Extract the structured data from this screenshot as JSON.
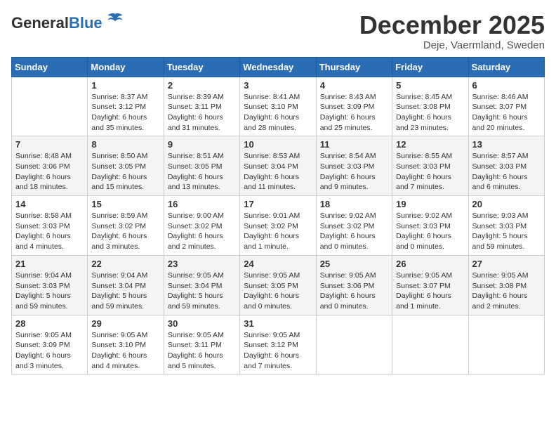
{
  "header": {
    "logo_general": "General",
    "logo_blue": "Blue",
    "month_title": "December 2025",
    "subtitle": "Deje, Vaermland, Sweden"
  },
  "days_of_week": [
    "Sunday",
    "Monday",
    "Tuesday",
    "Wednesday",
    "Thursday",
    "Friday",
    "Saturday"
  ],
  "weeks": [
    [
      {
        "day": "",
        "info": ""
      },
      {
        "day": "1",
        "info": "Sunrise: 8:37 AM\nSunset: 3:12 PM\nDaylight: 6 hours\nand 35 minutes."
      },
      {
        "day": "2",
        "info": "Sunrise: 8:39 AM\nSunset: 3:11 PM\nDaylight: 6 hours\nand 31 minutes."
      },
      {
        "day": "3",
        "info": "Sunrise: 8:41 AM\nSunset: 3:10 PM\nDaylight: 6 hours\nand 28 minutes."
      },
      {
        "day": "4",
        "info": "Sunrise: 8:43 AM\nSunset: 3:09 PM\nDaylight: 6 hours\nand 25 minutes."
      },
      {
        "day": "5",
        "info": "Sunrise: 8:45 AM\nSunset: 3:08 PM\nDaylight: 6 hours\nand 23 minutes."
      },
      {
        "day": "6",
        "info": "Sunrise: 8:46 AM\nSunset: 3:07 PM\nDaylight: 6 hours\nand 20 minutes."
      }
    ],
    [
      {
        "day": "7",
        "info": "Sunrise: 8:48 AM\nSunset: 3:06 PM\nDaylight: 6 hours\nand 18 minutes."
      },
      {
        "day": "8",
        "info": "Sunrise: 8:50 AM\nSunset: 3:05 PM\nDaylight: 6 hours\nand 15 minutes."
      },
      {
        "day": "9",
        "info": "Sunrise: 8:51 AM\nSunset: 3:05 PM\nDaylight: 6 hours\nand 13 minutes."
      },
      {
        "day": "10",
        "info": "Sunrise: 8:53 AM\nSunset: 3:04 PM\nDaylight: 6 hours\nand 11 minutes."
      },
      {
        "day": "11",
        "info": "Sunrise: 8:54 AM\nSunset: 3:03 PM\nDaylight: 6 hours\nand 9 minutes."
      },
      {
        "day": "12",
        "info": "Sunrise: 8:55 AM\nSunset: 3:03 PM\nDaylight: 6 hours\nand 7 minutes."
      },
      {
        "day": "13",
        "info": "Sunrise: 8:57 AM\nSunset: 3:03 PM\nDaylight: 6 hours\nand 6 minutes."
      }
    ],
    [
      {
        "day": "14",
        "info": "Sunrise: 8:58 AM\nSunset: 3:03 PM\nDaylight: 6 hours\nand 4 minutes."
      },
      {
        "day": "15",
        "info": "Sunrise: 8:59 AM\nSunset: 3:02 PM\nDaylight: 6 hours\nand 3 minutes."
      },
      {
        "day": "16",
        "info": "Sunrise: 9:00 AM\nSunset: 3:02 PM\nDaylight: 6 hours\nand 2 minutes."
      },
      {
        "day": "17",
        "info": "Sunrise: 9:01 AM\nSunset: 3:02 PM\nDaylight: 6 hours\nand 1 minute."
      },
      {
        "day": "18",
        "info": "Sunrise: 9:02 AM\nSunset: 3:02 PM\nDaylight: 6 hours\nand 0 minutes."
      },
      {
        "day": "19",
        "info": "Sunrise: 9:02 AM\nSunset: 3:03 PM\nDaylight: 6 hours\nand 0 minutes."
      },
      {
        "day": "20",
        "info": "Sunrise: 9:03 AM\nSunset: 3:03 PM\nDaylight: 5 hours\nand 59 minutes."
      }
    ],
    [
      {
        "day": "21",
        "info": "Sunrise: 9:04 AM\nSunset: 3:03 PM\nDaylight: 5 hours\nand 59 minutes."
      },
      {
        "day": "22",
        "info": "Sunrise: 9:04 AM\nSunset: 3:04 PM\nDaylight: 5 hours\nand 59 minutes."
      },
      {
        "day": "23",
        "info": "Sunrise: 9:05 AM\nSunset: 3:04 PM\nDaylight: 5 hours\nand 59 minutes."
      },
      {
        "day": "24",
        "info": "Sunrise: 9:05 AM\nSunset: 3:05 PM\nDaylight: 6 hours\nand 0 minutes."
      },
      {
        "day": "25",
        "info": "Sunrise: 9:05 AM\nSunset: 3:06 PM\nDaylight: 6 hours\nand 0 minutes."
      },
      {
        "day": "26",
        "info": "Sunrise: 9:05 AM\nSunset: 3:07 PM\nDaylight: 6 hours\nand 1 minute."
      },
      {
        "day": "27",
        "info": "Sunrise: 9:05 AM\nSunset: 3:08 PM\nDaylight: 6 hours\nand 2 minutes."
      }
    ],
    [
      {
        "day": "28",
        "info": "Sunrise: 9:05 AM\nSunset: 3:09 PM\nDaylight: 6 hours\nand 3 minutes."
      },
      {
        "day": "29",
        "info": "Sunrise: 9:05 AM\nSunset: 3:10 PM\nDaylight: 6 hours\nand 4 minutes."
      },
      {
        "day": "30",
        "info": "Sunrise: 9:05 AM\nSunset: 3:11 PM\nDaylight: 6 hours\nand 5 minutes."
      },
      {
        "day": "31",
        "info": "Sunrise: 9:05 AM\nSunset: 3:12 PM\nDaylight: 6 hours\nand 7 minutes."
      },
      {
        "day": "",
        "info": ""
      },
      {
        "day": "",
        "info": ""
      },
      {
        "day": "",
        "info": ""
      }
    ]
  ]
}
